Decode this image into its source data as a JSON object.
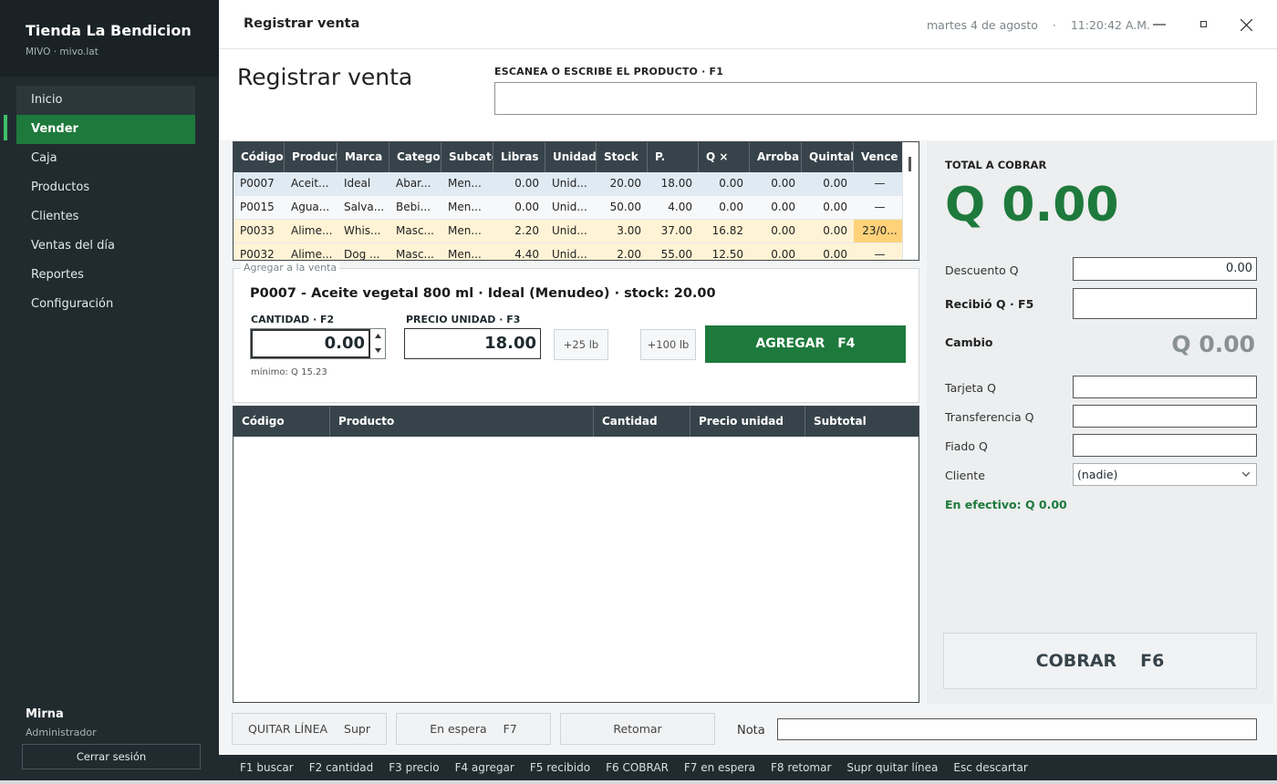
{
  "sidebar": {
    "app_name": "Tienda La Bendicion",
    "app_sub": "MIVO · mivo.lat",
    "items": [
      {
        "label": "Inicio"
      },
      {
        "label": "Vender"
      },
      {
        "label": "Caja"
      },
      {
        "label": "Productos"
      },
      {
        "label": "Clientes"
      },
      {
        "label": "Ventas del día"
      },
      {
        "label": "Reportes"
      },
      {
        "label": "Configuración"
      }
    ],
    "active_item": "Vender",
    "user_name": "Mirna",
    "user_role": "Administrador",
    "logout_label": "Cerrar sesión"
  },
  "topbar": {
    "window_title": "Registrar venta",
    "date": "martes 4 de agosto",
    "separator": "·",
    "time": "11:20:42 A.M."
  },
  "header": {
    "page_title": "Registrar venta",
    "scan_label": "ESCANEA O ESCRIBE EL PRODUCTO   ·   F1",
    "scan_value": ""
  },
  "product_grid": {
    "columns": [
      "Código",
      "Product",
      "Marca",
      "Categor",
      "Subcate",
      "Libras",
      "Unidad",
      "Stock",
      "P.",
      "Q ×",
      "Arroba",
      "Quintal",
      "Vence"
    ],
    "rows": [
      [
        "P0007",
        "Aceit...",
        "Ideal",
        "Abar...",
        "Men...",
        "0.00",
        "Unid...",
        "20.00",
        "18.00",
        "0.00",
        "0.00",
        "0.00",
        "—"
      ],
      [
        "P0015",
        "Agua...",
        "Salva...",
        "Bebi...",
        "Men...",
        "0.00",
        "Unid...",
        "50.00",
        "4.00",
        "0.00",
        "0.00",
        "0.00",
        "—"
      ],
      [
        "P0033",
        "Alime...",
        "Whis...",
        "Masc...",
        "Men...",
        "2.20",
        "Unid...",
        "3.00",
        "37.00",
        "16.82",
        "0.00",
        "0.00",
        "23/0..."
      ],
      [
        "P0032",
        "Alime...",
        "Dog ...",
        "Masc...",
        "Men...",
        "4.40",
        "Unid...",
        "2.00",
        "55.00",
        "12.50",
        "0.00",
        "0.00",
        "—"
      ]
    ]
  },
  "add_to_sale": {
    "legend": "Agregar a la venta",
    "product_line": "P0007  -  Aceite vegetal 800 ml  ·  Ideal (Menudeo)   ·   stock: 20.00",
    "qty_label": "CANTIDAD   ·   F2",
    "qty_value": "0.00",
    "price_label": "PRECIO UNIDAD   ·   F3",
    "price_value": "18.00",
    "min_note": "mínimo: Q 15.23",
    "chip_25": "+25 lb",
    "chip_100": "+100 lb",
    "add_label": "AGREGAR",
    "add_key": "F4"
  },
  "cart": {
    "columns": [
      "Código",
      "Producto",
      "Cantidad",
      "Precio unidad",
      "Subtotal"
    ],
    "rows": []
  },
  "payment": {
    "total_label": "TOTAL A COBRAR",
    "total_value": "Q 0.00",
    "descuento_label": "Descuento Q",
    "descuento_value": "0.00",
    "recibio_label": "Recibió Q   ·   F5",
    "recibio_value": "",
    "cambio_label": "Cambio",
    "cambio_value": "Q 0.00",
    "tarjeta_label": "Tarjeta Q",
    "transferencia_label": "Transferencia Q",
    "fiado_label": "Fiado Q",
    "cliente_label": "Cliente",
    "cliente_value": "(nadie)",
    "efectivo_text": "En efectivo: Q 0.00",
    "cobrar_label": "COBRAR",
    "cobrar_key": "F6"
  },
  "actions": {
    "quitar_label": "QUITAR LÍNEA",
    "quitar_key": "Supr",
    "espera_label": "En espera",
    "espera_key": "F7",
    "retomar_label": "Retomar",
    "nota_label": "Nota",
    "nota_value": ""
  },
  "shortcuts": [
    "F1 buscar",
    "F2 cantidad",
    "F3 precio",
    "F4 agregar",
    "F5 recibido",
    "F6 COBRAR",
    "F7 en espera",
    "F8 retomar",
    "Supr quitar línea",
    "Esc descartar"
  ],
  "colors": {
    "accent_green": "#1e7a3c",
    "sidebar_bg": "#212b2f",
    "grid_header": "#37434a",
    "warn_row": "#fff3d5",
    "expiry_cell": "#ffd27a"
  },
  "icons": {
    "minimize": "minimize-icon",
    "maximize": "maximize-icon",
    "close": "close-icon",
    "chevron": "chevron-down-icon"
  }
}
